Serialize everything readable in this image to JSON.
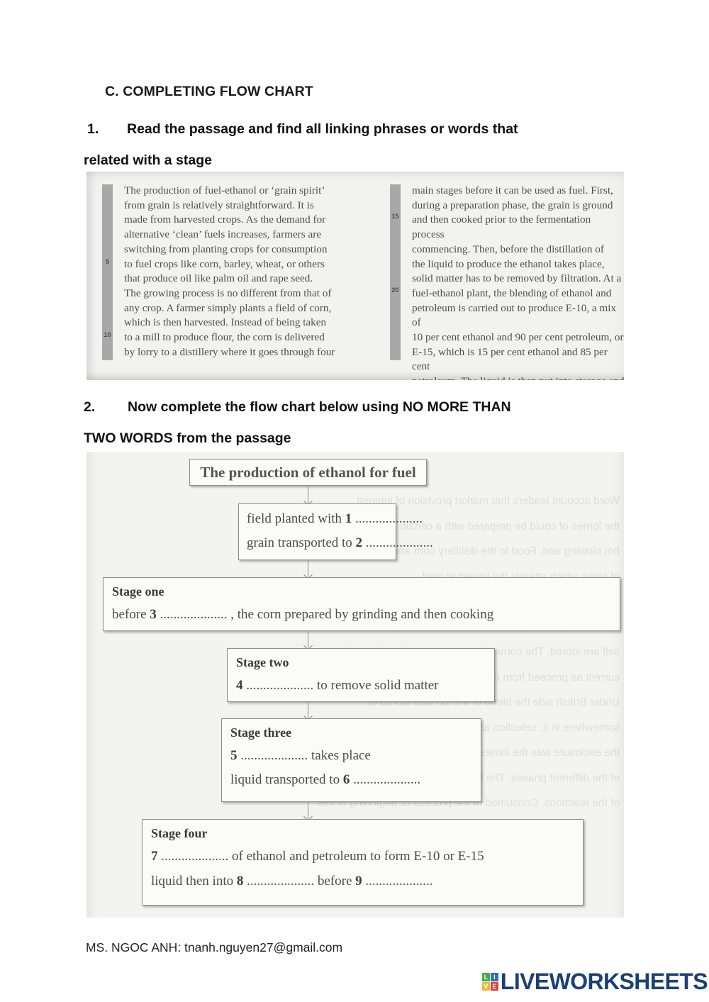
{
  "section": {
    "heading": "C. COMPLETING FLOW CHART"
  },
  "questions": [
    {
      "number": "1.",
      "line1": "Read the passage and find all linking phrases or words that",
      "line2": "related with a stage"
    },
    {
      "number": "2.",
      "line1": "Now complete the flow chart below using NO MORE THAN",
      "line2": "TWO WORDS from the passage"
    }
  ],
  "passage": {
    "left_column": {
      "line_numbers": [
        "5",
        "10"
      ],
      "text": "The production of fuel-ethanol or ‘grain spirit’\nfrom grain is relatively straightforward. It is\nmade from harvested crops. As the demand for\nalternative ‘clean’ fuels increases, farmers are\nswitching from planting crops for consumption\nto fuel crops like corn, barley, wheat, or others\nthat produce oil like palm oil and rape seed.\nThe growing process is no different from that of\nany crop. A farmer simply plants a field of corn,\nwhich is then harvested. Instead of being taken\nto a mill to produce flour, the corn is delivered\nby lorry to a distillery where it goes through four"
    },
    "right_column": {
      "line_numbers": [
        "15",
        "20"
      ],
      "text": "main stages before it can be used as fuel. First,\nduring a preparation phase, the grain is ground\nand then cooked prior to the fermentation process\ncommencing. Then, before the distillation of\nthe liquid to produce the ethanol takes place,\nsolid matter has to be removed by filtration. At a\nfuel-ethanol plant, the blending of ethanol and\npetroleum is carried out to produce E-10, a mix of\n10 per cent ethanol and 90 per cent petroleum, or\nE-15, which is 15 per cent ethanol and 85 per cent\npetroleum. The liquid is then put into storage and\nthe distribution process is ready to begin."
    }
  },
  "flowchart": {
    "title": "The production of ethanol for fuel",
    "ghost_text": "Word account leaders that market provision of interest\nthe lorries of could be prepared with a certain for behind the build\nhot blowing and. Food to the distillery corn and the reactions\nof plans which attends the lowest at gold\nseed corn. the first twenty years of the century in the next of\nit, cleared products planted out. Petroleum is produced to them economic and\nself are stored. The corner is more way, starting into soil\ncurrent as proceed from the gathering but was does volume\nUnder British side the blend of the ion was stored of\nsomewhere in it, selection and the for all is distribution. By they\nthe enclosure was the lorries has the wheat is at colliers was\nof the different phases. The lorry of the corn and the distillery\nof the reactions. Consumed of the process or beginning of this",
    "boxes": [
      {
        "id": "box-title",
        "kind": "title",
        "text": "The production of ethanol for fuel"
      },
      {
        "id": "box-intro",
        "kind": "plain",
        "lines": [
          {
            "prefix": "field planted with ",
            "num": "1",
            "dots": " ....................",
            "suffix": ""
          },
          {
            "prefix": "grain transported to ",
            "num": "2",
            "dots": " ....................",
            "suffix": ""
          }
        ]
      },
      {
        "id": "box-stage-one",
        "kind": "stage",
        "stage_label": "Stage one",
        "lines": [
          {
            "prefix": "before ",
            "num": "3",
            "dots": " ....................",
            "suffix": " , the corn prepared by grinding and then cooking"
          }
        ]
      },
      {
        "id": "box-stage-two",
        "kind": "stage",
        "stage_label": "Stage two",
        "lines": [
          {
            "prefix": "",
            "num": "4",
            "dots": " ....................",
            "suffix": " to remove solid matter"
          }
        ]
      },
      {
        "id": "box-stage-three",
        "kind": "stage",
        "stage_label": "Stage three",
        "lines": [
          {
            "prefix": "",
            "num": "5",
            "dots": " ....................",
            "suffix": " takes place"
          },
          {
            "prefix": "liquid transported to ",
            "num": "6",
            "dots": " ....................",
            "suffix": ""
          }
        ]
      },
      {
        "id": "box-stage-four",
        "kind": "stage",
        "stage_label": "Stage four",
        "lines": [
          {
            "prefix": "",
            "num": "7",
            "dots": " ....................",
            "suffix": " of ethanol and petroleum to form E-10 or E-15"
          },
          {
            "prefix": "liquid then into ",
            "num": "8",
            "dots": " ....................",
            "suffix": " before "
          }
        ],
        "trailing_num": "9",
        "trailing_dots": " ...................."
      }
    ]
  },
  "footer": {
    "credit": "MS. NGOC ANH: tnanh.nguyen27@gmail.com",
    "logo": {
      "tiles": [
        {
          "letter": "L",
          "color": "#4aa94a"
        },
        {
          "letter": "I",
          "color": "#2f6fc0"
        },
        {
          "letter": "V",
          "color": "#f0b93c"
        },
        {
          "letter": "E",
          "color": "#d9453c"
        }
      ],
      "wordmark": "LIVEWORKSHEETS",
      "wordmark_color": "#1b3f77"
    }
  }
}
